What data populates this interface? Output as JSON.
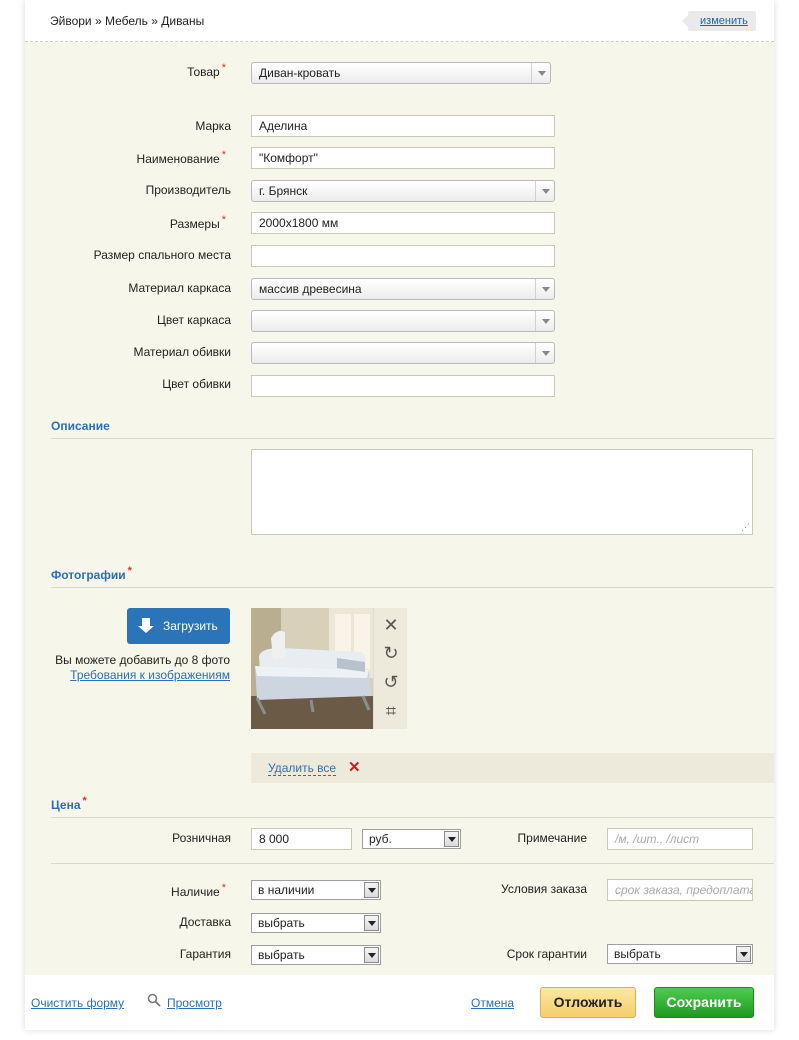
{
  "breadcrumb": "Эйвори » Мебель » Диваны",
  "change_label": "изменить",
  "form": {
    "product": {
      "label": "Товар",
      "value": "Диван-кровать"
    },
    "brand": {
      "label": "Марка",
      "value": "Аделина"
    },
    "name": {
      "label": "Наименование",
      "value": "\"Комфорт\""
    },
    "manufacturer": {
      "label": "Производитель",
      "value": "г. Брянск"
    },
    "size": {
      "label": "Размеры",
      "value": "2000x1800 мм"
    },
    "sleep_size": {
      "label": "Размер спального места",
      "value": ""
    },
    "frame_material": {
      "label": "Материал каркаса",
      "value": "массив древесина"
    },
    "frame_color": {
      "label": "Цвет каркаса",
      "value": ""
    },
    "upholstery_material": {
      "label": "Материал обивки",
      "value": ""
    },
    "upholstery_color": {
      "label": "Цвет обивки",
      "value": ""
    }
  },
  "required_mark": "*",
  "description": {
    "title": "Описание",
    "value": ""
  },
  "photos": {
    "title": "Фотографии",
    "upload_label": "Загрузить",
    "hint": "Вы можете добавить до 8 фото",
    "requirements_link": "Требования к изображениям",
    "delete_all": "Удалить все",
    "tools": [
      "close-icon",
      "rotate-right-icon",
      "rotate-left-icon",
      "crop-icon"
    ]
  },
  "price": {
    "title": "Цена",
    "retail_label": "Розничная",
    "retail_value": "8 000",
    "currency": "руб.",
    "note_label": "Примечание",
    "note_placeholder": "/м, /шт., /лист",
    "availability_label": "Наличие",
    "availability_value": "в наличии",
    "order_terms_label": "Условия заказа",
    "order_terms_placeholder": "срок заказа, предоплата",
    "delivery_label": "Доставка",
    "delivery_value": "выбрать",
    "warranty_label": "Гарантия",
    "warranty_value": "выбрать",
    "warranty_term_label": "Срок гарантии",
    "warranty_term_value": "выбрать"
  },
  "footer": {
    "clear": "Очистить форму",
    "preview": "Просмотр",
    "cancel": "Отмена",
    "defer": "Отложить",
    "save": "Сохранить"
  },
  "colors": {
    "accent": "#2a6fb8",
    "save": "#1f9a21",
    "defer": "#f5cf6a",
    "panel": "#f6f6ea"
  }
}
